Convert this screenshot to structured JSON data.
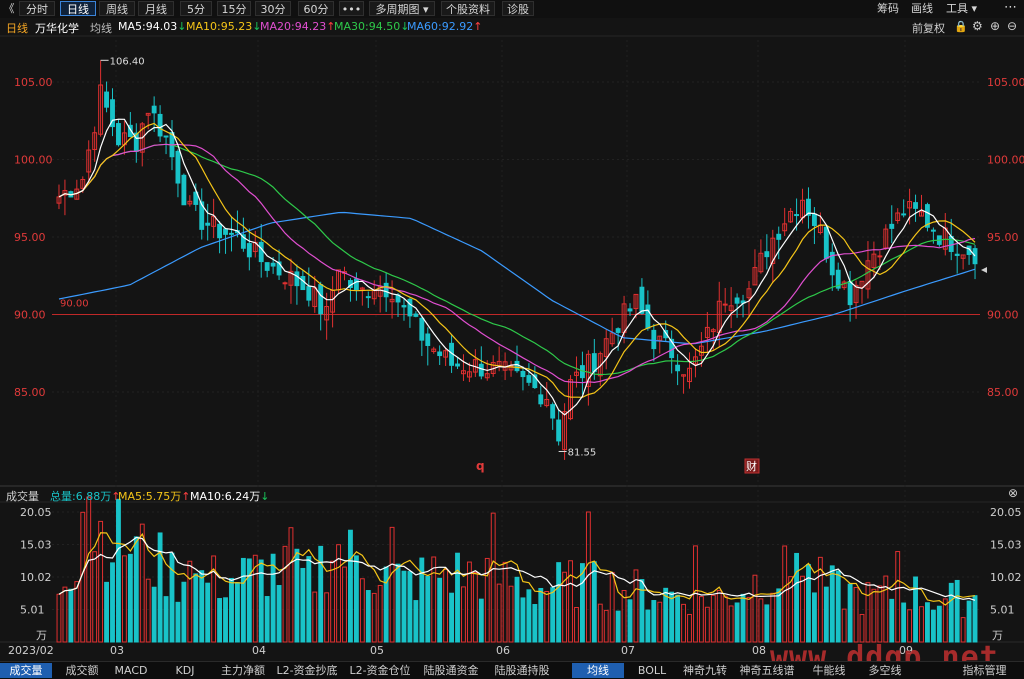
{
  "toolbar": {
    "back_icon": "《",
    "tabs": [
      "分时",
      "日线",
      "周线",
      "月线",
      "5分",
      "15分",
      "30分",
      "60分",
      "•••",
      "多周期图 ▾",
      "个股资料",
      "诊股"
    ],
    "active_tab": "日线",
    "right": [
      "筹码",
      "画线",
      "工具 ▾"
    ]
  },
  "ma_header": {
    "period": "日线",
    "name": "万华化学",
    "avg_label": "均线",
    "ma5": "MA5:94.03",
    "ma5_arrow": "↓",
    "ma10": "MA10:95.23",
    "ma10_arrow": "↓",
    "ma20": "MA20:94.23",
    "ma20_arrow": "↑",
    "ma30": "MA30:94.50",
    "ma30_arrow": "↓",
    "ma60": "MA60:92.92",
    "ma60_arrow": "↑",
    "adjust": "前复权",
    "colors": {
      "ma5": "#ffffff",
      "ma10": "#f5c518",
      "ma20": "#e04fd0",
      "ma30": "#2ec94a",
      "ma60": "#3b9bff"
    }
  },
  "price_axis": {
    "ticks": [
      "105.00",
      "100.00",
      "95.00",
      "90.00",
      "85.00"
    ],
    "tick_values": [
      105,
      100,
      95,
      90,
      85
    ]
  },
  "price_marks": {
    "high": "106.40",
    "low": "81.55",
    "line_label": "90.00",
    "line_value": 90,
    "icon_q": "q",
    "icon_cai": "财"
  },
  "volume_header": {
    "label": "成交量",
    "total": "总量:6.88万",
    "total_arrow": "↑",
    "ma5": "MA5:5.75万",
    "ma5_arrow": "↑",
    "ma10": "MA10:6.24万",
    "ma10_arrow": "↓"
  },
  "volume_axis": {
    "ticks": [
      "20.05",
      "15.03",
      "10.02",
      "5.01"
    ],
    "unit": "万",
    "tick_values": [
      20.05,
      15.03,
      10.02,
      5.01
    ]
  },
  "date_axis": [
    "2023/02",
    "03",
    "04",
    "05",
    "06",
    "07",
    "08",
    "09"
  ],
  "bottom_tabs": [
    "成交量",
    "成交额",
    "MACD",
    "KDJ",
    "主力净额",
    "L2-资金抄底",
    "L2-资金仓位",
    "陆股通资金",
    "陆股通持股",
    "均线",
    "BOLL",
    "神奇九转",
    "神奇五线谱",
    "牛能线",
    "多空线",
    "指标管理"
  ],
  "bottom_active": [
    "成交量",
    "均线"
  ],
  "watermark": "www.ddgp.net",
  "candles": {
    "count": 155,
    "up_color": "#e03030",
    "down_color": "#19c3c8",
    "anchors": [
      [
        0,
        97.6
      ],
      [
        4,
        98.8
      ],
      [
        7,
        104.2
      ],
      [
        10,
        101.3
      ],
      [
        13,
        101.2
      ],
      [
        15,
        103.4
      ],
      [
        18,
        101.4
      ],
      [
        22,
        96.6
      ],
      [
        26,
        95.6
      ],
      [
        30,
        95.0
      ],
      [
        34,
        93.5
      ],
      [
        38,
        92.6
      ],
      [
        42,
        91.6
      ],
      [
        45,
        89.9
      ],
      [
        47,
        93.3
      ],
      [
        50,
        91.2
      ],
      [
        53,
        92.0
      ],
      [
        56,
        91.7
      ],
      [
        58,
        90.2
      ],
      [
        62,
        88.1
      ],
      [
        66,
        86.8
      ],
      [
        70,
        86.7
      ],
      [
        74,
        86.4
      ],
      [
        78,
        85.6
      ],
      [
        82,
        84.8
      ],
      [
        84,
        82.3
      ],
      [
        86,
        85.5
      ],
      [
        90,
        87.1
      ],
      [
        94,
        89.5
      ],
      [
        97,
        90.7
      ],
      [
        100,
        88.4
      ],
      [
        103,
        87.6
      ],
      [
        106,
        86.2
      ],
      [
        108,
        87.7
      ],
      [
        112,
        91.2
      ],
      [
        116,
        91.6
      ],
      [
        119,
        94.3
      ],
      [
        122,
        96.2
      ],
      [
        125,
        97.6
      ],
      [
        128,
        95.3
      ],
      [
        130,
        93.1
      ],
      [
        133,
        91.3
      ],
      [
        136,
        93.5
      ],
      [
        139,
        95.1
      ],
      [
        142,
        96.7
      ],
      [
        145,
        96.4
      ],
      [
        148,
        95.2
      ],
      [
        151,
        94.5
      ],
      [
        154,
        94.03
      ]
    ],
    "ma60_values": [
      91.0,
      91.9,
      94.3,
      95.9,
      96.6,
      96.2,
      94.1,
      90.9,
      88.5,
      88.1,
      88.9,
      90.0,
      91.5,
      92.92
    ]
  },
  "volume": {
    "ma5_color": "#f5c518",
    "ma10_color": "#ffffff",
    "anchors": [
      [
        0,
        8.5
      ],
      [
        5,
        18.0
      ],
      [
        12,
        14.8
      ],
      [
        20,
        10.0
      ],
      [
        28,
        9.5
      ],
      [
        36,
        11.2
      ],
      [
        42,
        9.5
      ],
      [
        46,
        14.5
      ],
      [
        52,
        11.5
      ],
      [
        58,
        9.0
      ],
      [
        64,
        10.6
      ],
      [
        72,
        10.3
      ],
      [
        80,
        8.2
      ],
      [
        88,
        9.3
      ],
      [
        96,
        8.0
      ],
      [
        104,
        7.3
      ],
      [
        112,
        6.8
      ],
      [
        118,
        9.8
      ],
      [
        124,
        10.8
      ],
      [
        130,
        8.2
      ],
      [
        136,
        6.8
      ],
      [
        142,
        8.0
      ],
      [
        148,
        6.5
      ],
      [
        154,
        6.88
      ]
    ]
  }
}
